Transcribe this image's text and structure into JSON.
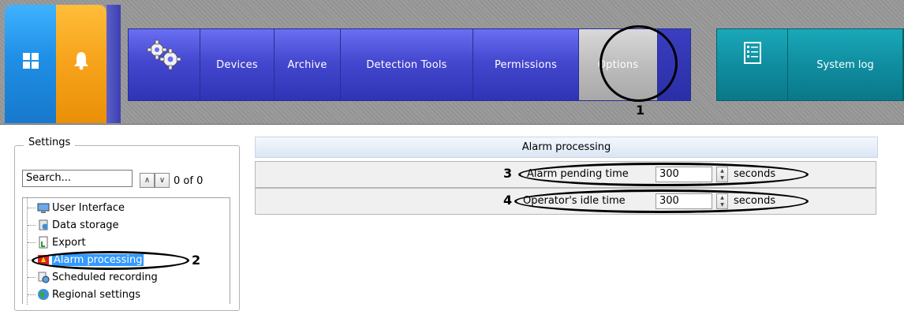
{
  "nav": {
    "items": [
      "Devices",
      "Archive",
      "Detection Tools",
      "Permissions",
      "Options"
    ],
    "active": "Options",
    "secondary": [
      "System log"
    ]
  },
  "settings": {
    "legend": "Settings",
    "search_placeholder": "Search...",
    "counter": "0 of 0",
    "tree": [
      "User Interface",
      "Data storage",
      "Export",
      "Alarm processing",
      "Scheduled recording",
      "Regional settings"
    ],
    "selected": "Alarm processing"
  },
  "alarm": {
    "title": "Alarm processing",
    "rows": [
      {
        "label": "Alarm pending time",
        "value": "300",
        "unit": "seconds"
      },
      {
        "label": "Operator's idle time",
        "value": "300",
        "unit": "seconds"
      }
    ]
  },
  "annotations": [
    "1",
    "2",
    "3",
    "4"
  ],
  "colors": {
    "nav_blue": "#4448cf",
    "teal": "#0f8ea0",
    "windows_tile": "#1f8fe6",
    "bell_tile": "#f7a51c",
    "selection": "#3399ff"
  },
  "icons": {
    "windows": "windows-icon",
    "bell": "bell-icon",
    "gears": "gears-icon",
    "log": "system-log-icon"
  }
}
